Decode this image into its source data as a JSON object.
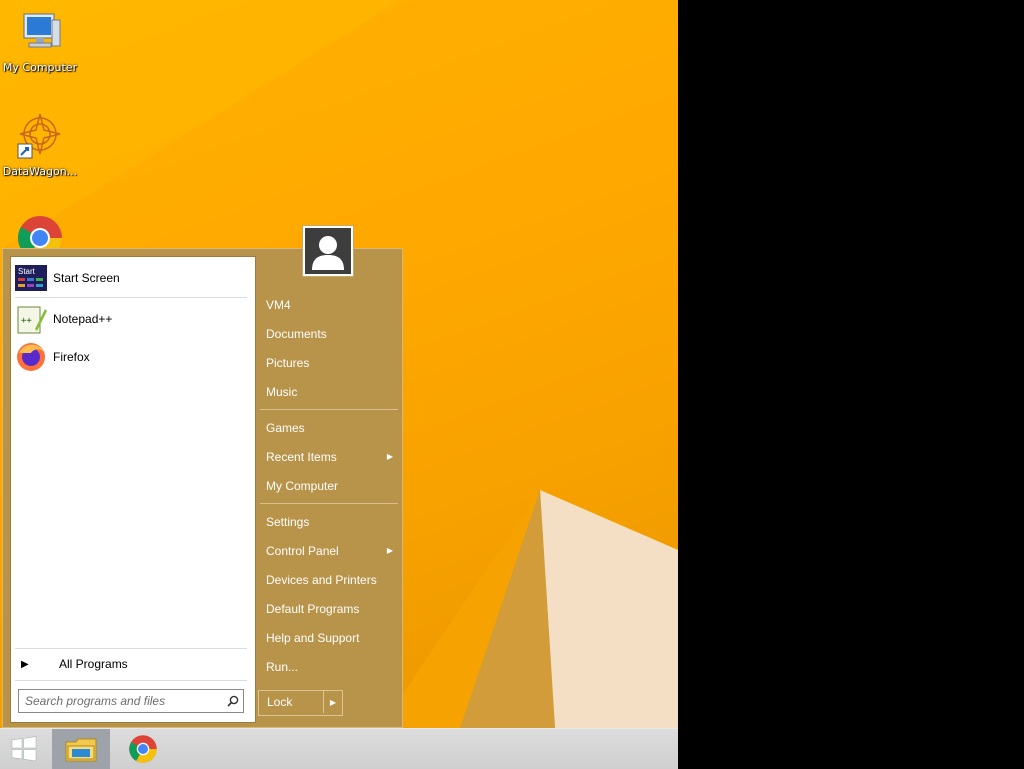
{
  "desktop": {
    "icons": [
      {
        "label": "My Computer",
        "icon": "computer-icon"
      },
      {
        "label": "DataWagon...",
        "icon": "datawagon-icon"
      },
      {
        "label": "",
        "icon": "chrome-icon"
      }
    ]
  },
  "start_menu": {
    "pinned": [
      {
        "label": "Start Screen",
        "icon": "start-screen-icon",
        "badge": "Start"
      },
      {
        "label": "Notepad++",
        "icon": "notepadpp-icon"
      },
      {
        "label": "Firefox",
        "icon": "firefox-icon"
      }
    ],
    "all_programs_label": "All Programs",
    "search_placeholder": "Search programs and files",
    "right_items": [
      {
        "label": "VM4",
        "submenu": false
      },
      {
        "label": "Documents",
        "submenu": false
      },
      {
        "label": "Pictures",
        "submenu": false
      },
      {
        "label": "Music",
        "submenu": false
      },
      {
        "label": "Games",
        "submenu": false
      },
      {
        "label": "Recent Items",
        "submenu": true
      },
      {
        "label": "My Computer",
        "submenu": false
      },
      {
        "label": "Settings",
        "submenu": false
      },
      {
        "label": "Control Panel",
        "submenu": true
      },
      {
        "label": "Devices and Printers",
        "submenu": false
      },
      {
        "label": "Default Programs",
        "submenu": false
      },
      {
        "label": "Help and Support",
        "submenu": false
      },
      {
        "label": "Run...",
        "submenu": false
      }
    ],
    "lock_label": "Lock"
  },
  "taskbar": {
    "items": [
      {
        "icon": "windows-start-icon"
      },
      {
        "icon": "file-explorer-icon"
      },
      {
        "icon": "chrome-icon"
      }
    ]
  },
  "colors": {
    "wallpaper": "#ffa800",
    "menu_panel": "#b8934a",
    "taskbar": "#d6d6d6"
  }
}
